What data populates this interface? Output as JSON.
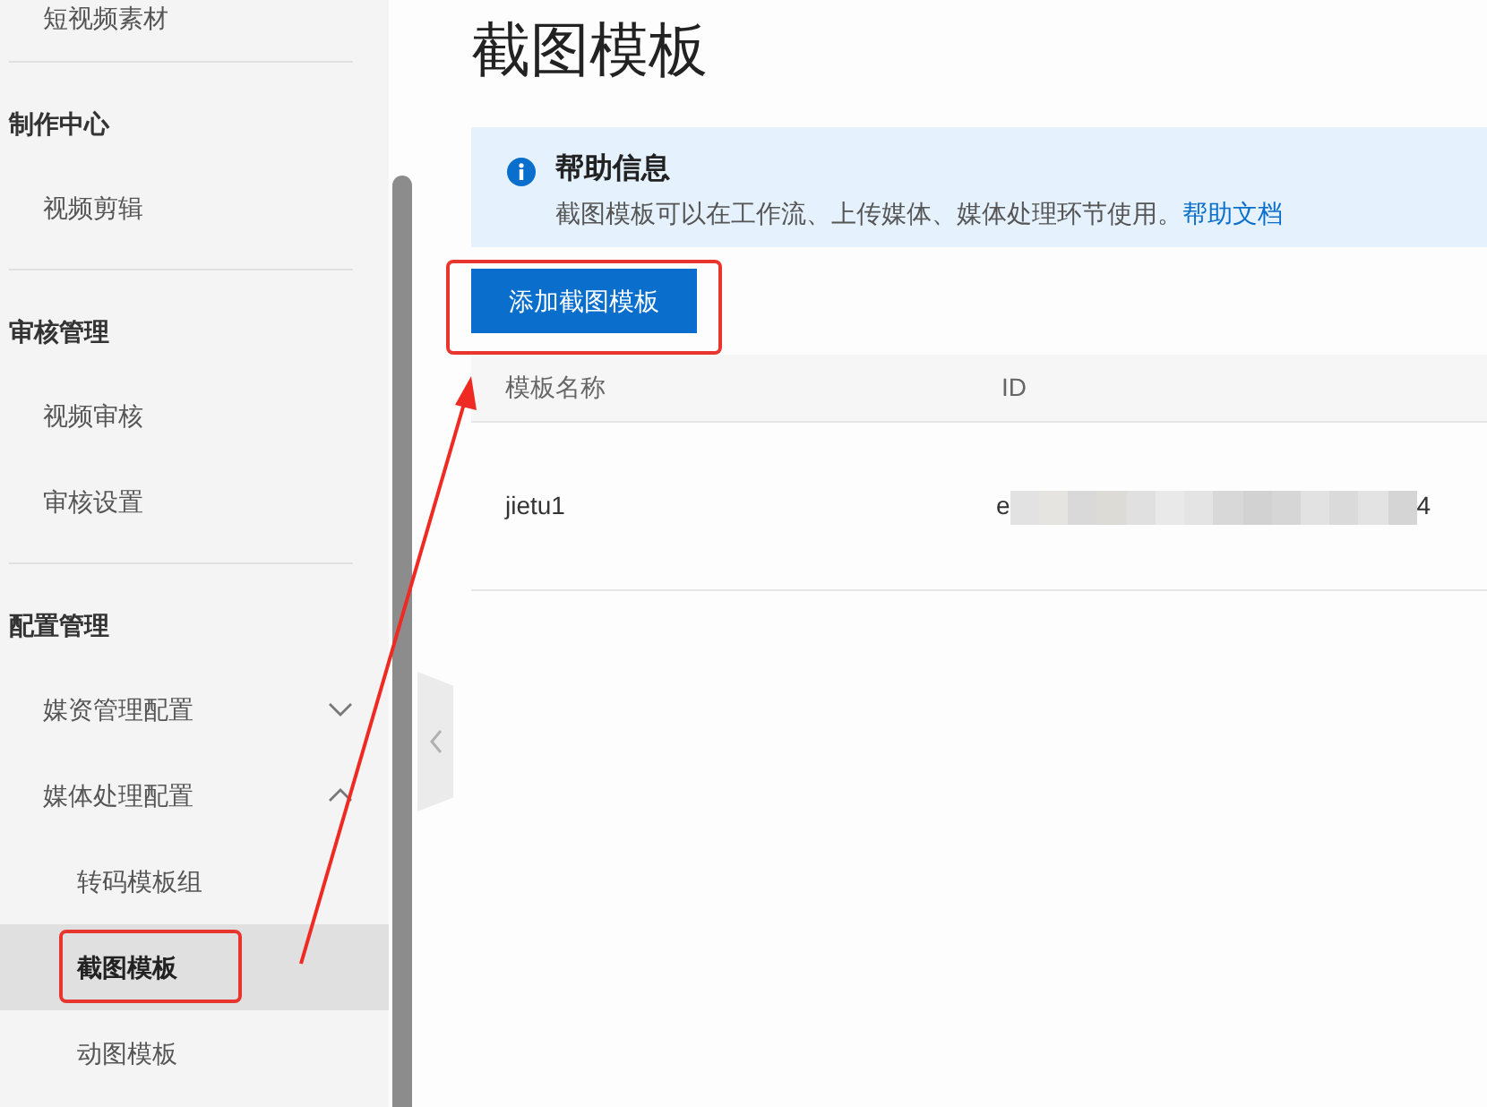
{
  "page": {
    "title": "截图模板"
  },
  "sidebar": {
    "groups": [
      {
        "items": [
          {
            "label": "短视频素材",
            "selected": false
          }
        ]
      },
      {
        "title": "制作中心",
        "items": [
          {
            "label": "视频剪辑",
            "selected": false
          }
        ]
      },
      {
        "title": "审核管理",
        "items": [
          {
            "label": "视频审核",
            "selected": false
          },
          {
            "label": "审核设置",
            "selected": false
          }
        ]
      },
      {
        "title": "配置管理",
        "items": [
          {
            "label": "媒资管理配置",
            "selected": false,
            "expanded": false
          },
          {
            "label": "媒体处理配置",
            "selected": false,
            "expanded": true,
            "children": [
              {
                "label": "转码模板组",
                "selected": false
              },
              {
                "label": "截图模板",
                "selected": true
              },
              {
                "label": "动图模板",
                "selected": false
              }
            ]
          }
        ]
      }
    ]
  },
  "help": {
    "title": "帮助信息",
    "text": "截图模板可以在工作流、上传媒体、媒体处理环节使用。",
    "link": "帮助文档"
  },
  "add_button": {
    "label": "添加截图模板"
  },
  "table": {
    "columns": [
      "模板名称",
      "ID"
    ],
    "rows": [
      {
        "name": "jietu1",
        "id": {
          "visible_start": "e",
          "visible_end": "4",
          "blurred": true
        }
      }
    ]
  }
}
